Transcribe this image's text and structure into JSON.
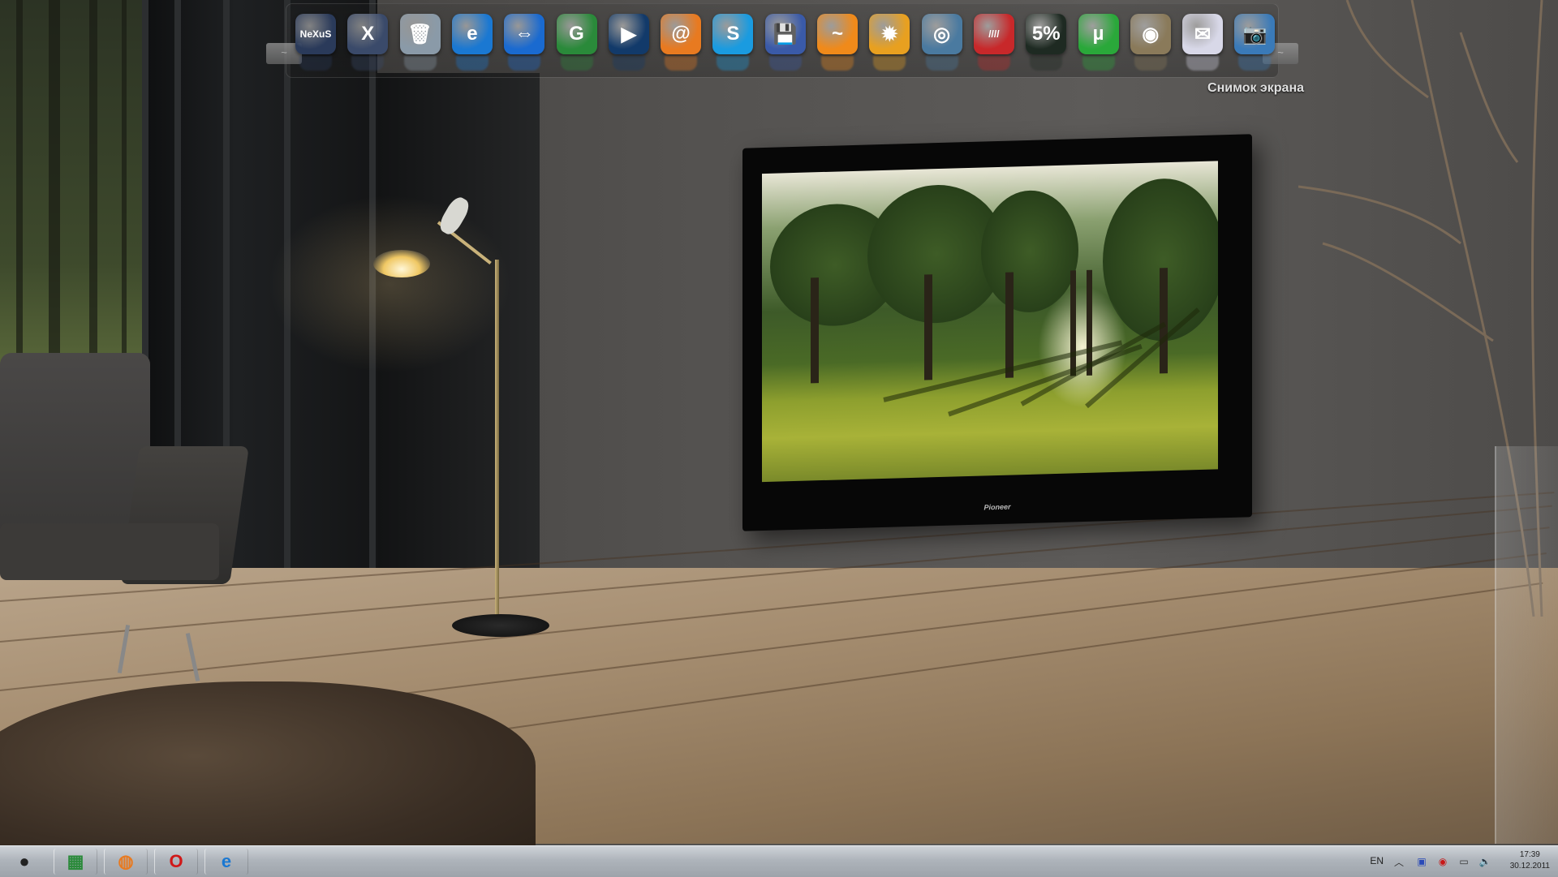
{
  "desktop": {
    "background": "living room with floor lamp, armchair and wall-mounted TV"
  },
  "dock": {
    "caption": "Снимок экрана",
    "items": [
      {
        "name": "nexus",
        "glyph": "NeXuS",
        "color": "#2a3a5a"
      },
      {
        "name": "xion",
        "glyph": "X",
        "color": "#3a4a6a"
      },
      {
        "name": "recycle-bin",
        "glyph": "🗑",
        "color": "#8a9aa8"
      },
      {
        "name": "internet-explorer",
        "glyph": "e",
        "color": "#1a78d2"
      },
      {
        "name": "teamviewer",
        "glyph": "⇔",
        "color": "#1a6ad0"
      },
      {
        "name": "g-app",
        "glyph": "G",
        "color": "#2a8a3a"
      },
      {
        "name": "media-player",
        "glyph": "▶",
        "color": "#123a6a"
      },
      {
        "name": "mail",
        "glyph": "@",
        "color": "#e87a20"
      },
      {
        "name": "skype",
        "glyph": "S",
        "color": "#1a9be0"
      },
      {
        "name": "save",
        "glyph": "💾",
        "color": "#3a5aa8"
      },
      {
        "name": "aimp",
        "glyph": "~",
        "color": "#f08a1a"
      },
      {
        "name": "autumn-leaf",
        "glyph": "✹",
        "color": "#e8a020"
      },
      {
        "name": "cpu-tool",
        "glyph": "◎",
        "color": "#4a7aa0"
      },
      {
        "name": "striped-app",
        "glyph": "////",
        "color": "#c8282a"
      },
      {
        "name": "cpu-meter",
        "glyph": "5%",
        "color": "#1e2a22"
      },
      {
        "name": "utorrent",
        "glyph": "µ",
        "color": "#2aa83a"
      },
      {
        "name": "globe",
        "glyph": "◉",
        "color": "#8a7a5a"
      },
      {
        "name": "mail-agent",
        "glyph": "✉",
        "color": "#d8d8e8"
      },
      {
        "name": "screenshot",
        "glyph": "📷",
        "color": "#3a7ab8"
      }
    ]
  },
  "taskbar": {
    "buttons": [
      {
        "name": "apple-menu",
        "glyph": "",
        "color": "#222"
      },
      {
        "name": "desktop-show",
        "glyph": "▦",
        "color": "#2a8a3a"
      },
      {
        "name": "browser",
        "glyph": "◍",
        "color": "#e87a20"
      },
      {
        "name": "opera",
        "glyph": "O",
        "color": "#d01818"
      },
      {
        "name": "internet-explorer",
        "glyph": "e",
        "color": "#1a78d2"
      }
    ],
    "tray": {
      "language": "EN",
      "icons": [
        "chevron-up-icon",
        "save-icon",
        "antivirus-icon",
        "network-icon",
        "volume-icon"
      ],
      "time": "17:39",
      "date": "30.12.2011"
    }
  },
  "tv": {
    "brand": "Pioneer"
  }
}
